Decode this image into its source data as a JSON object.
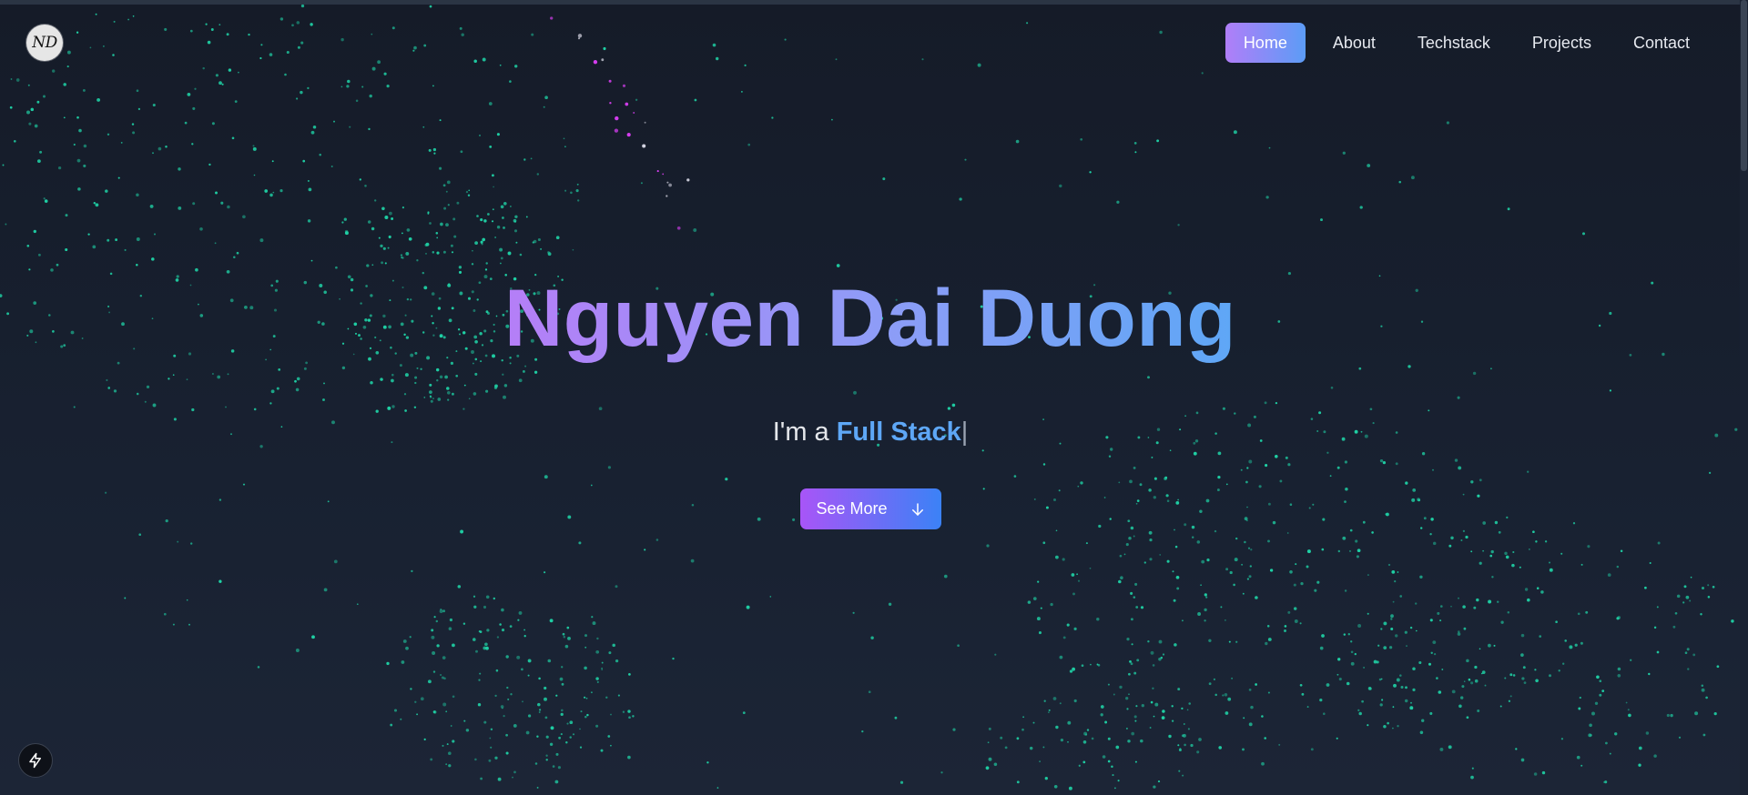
{
  "logo": {
    "text": "ND"
  },
  "nav": {
    "items": [
      {
        "label": "Home",
        "active": true
      },
      {
        "label": "About",
        "active": false
      },
      {
        "label": "Techstack",
        "active": false
      },
      {
        "label": "Projects",
        "active": false
      },
      {
        "label": "Contact",
        "active": false
      }
    ]
  },
  "hero": {
    "name": "Nguyen Dai Duong",
    "subtitle_prefix": "I'm a ",
    "role": "Full Stack",
    "cursor": "|",
    "cta_label": "See More",
    "cta_icon": "arrow-down-icon"
  },
  "colors": {
    "background": "#161d2b",
    "accent_purple": "#a855f7",
    "accent_blue": "#3b82f6",
    "particle_teal": "#1fd1a5",
    "particle_pink": "#e040fb"
  },
  "devtools": {
    "icon": "lightning-icon"
  }
}
